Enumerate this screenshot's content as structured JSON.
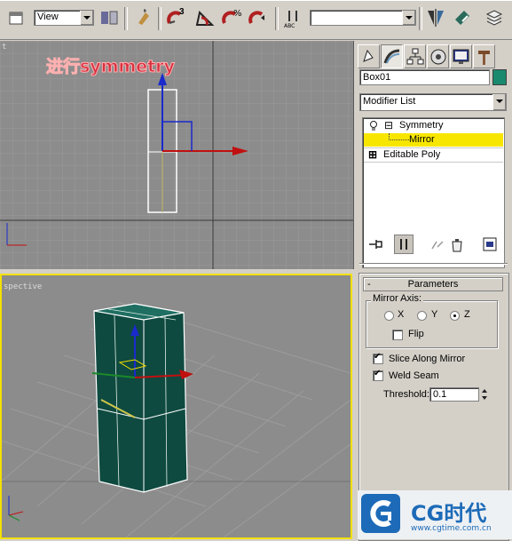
{
  "toolbar": {
    "view_dropdown": "View",
    "snap_count": "3",
    "selection_set_value": ""
  },
  "viewports": {
    "top": {
      "label": "t",
      "overlay_text": "进行symmetry"
    },
    "perspective": {
      "label": "spective"
    }
  },
  "panel": {
    "object_name": "Box01",
    "object_color": "#1a8a6e",
    "modifier_list": "Modifier List",
    "stack": [
      {
        "label": "Symmetry",
        "expander": "⊟",
        "selected": false
      },
      {
        "label": "Mirror",
        "expander": "",
        "selected": true
      },
      {
        "label": "Editable Poly",
        "expander": "⊞",
        "selected": false
      }
    ],
    "rollout": {
      "collapse": "-",
      "title": "Parameters",
      "mirror_axis_label": "Mirror Axis:",
      "axes": [
        {
          "label": "X",
          "checked": false
        },
        {
          "label": "Y",
          "checked": false
        },
        {
          "label": "Z",
          "checked": true
        }
      ],
      "flip_label": "Flip",
      "flip_checked": false,
      "slice_label": "Slice Along Mirror",
      "slice_checked": true,
      "weld_label": "Weld Seam",
      "weld_checked": true,
      "threshold_label": "Threshold:",
      "threshold_value": "0.1"
    }
  },
  "watermark": {
    "brand": "CG时代",
    "url": "www.cgtime.com.cn"
  },
  "colors": {
    "viewport_bg": "#8c8c8c",
    "selection_yellow": "#f7e600",
    "object_teal": "#0f4a40"
  }
}
